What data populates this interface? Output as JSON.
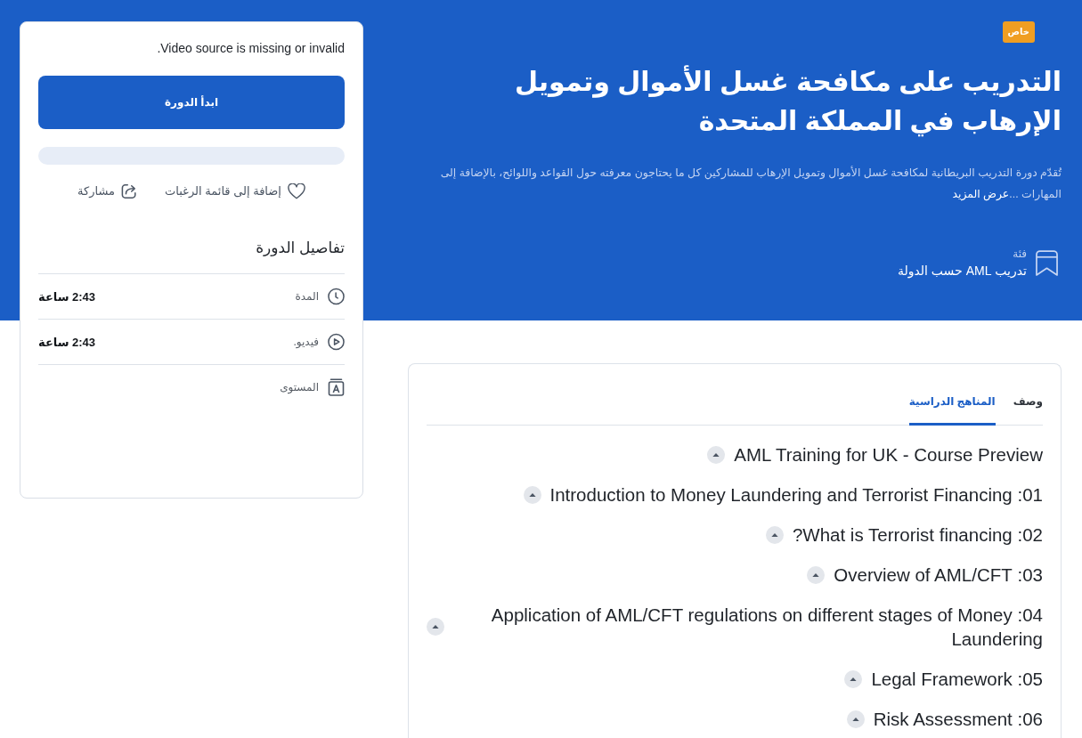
{
  "sidebar": {
    "video_message": "Video source is missing or invalid.",
    "start_button": "ابدأ الدورة",
    "progress": {
      "level": 0
    },
    "actions": [
      {
        "kind": "wishlist",
        "label": "إضافة إلى قائمة الرغبات"
      },
      {
        "kind": "share",
        "label": "مشاركة"
      }
    ],
    "details_title": "تفاصيل الدورة",
    "details": [
      {
        "kind": "duration",
        "label": "المدة",
        "value": "2:43 ساعة"
      },
      {
        "kind": "video",
        "label": "فيديو.",
        "value": "2:43 ساعة"
      },
      {
        "kind": "level",
        "label": "المستوى"
      }
    ]
  },
  "course": {
    "badge": "خاص",
    "title": "التدريب على مكافحة غسل الأموال وتمويل الإرهاب في المملكة المتحدة",
    "description": "تُقدّم دورة التدريب البريطانية لمكافحة غسل الأموال وتمويل الإرهاب للمشاركين كل ما يحتاجون معرفته حول القواعد واللوائح، بالإضافة إلى المهارات ...",
    "more_link": "عرض المزيد",
    "category": {
      "label": "فئة",
      "value": "تدريب AML حسب الدولة"
    }
  },
  "tabs": [
    {
      "label": "وصف",
      "selected": false
    },
    {
      "label": "المناهج الدراسية",
      "selected": true
    }
  ],
  "curriculum": [
    {
      "title": "AML Training for UK - Course Preview"
    },
    {
      "title": "01: Introduction to Money Laundering and Terrorist Financing"
    },
    {
      "title": "02: What is Terrorist financing?"
    },
    {
      "title": "03: Overview of AML/CFT"
    },
    {
      "title": "04: Application of AML/CFT regulations on different stages of Money Laundering"
    },
    {
      "title": "05: Legal Framework"
    },
    {
      "title": "06: Risk Assessment"
    }
  ]
}
